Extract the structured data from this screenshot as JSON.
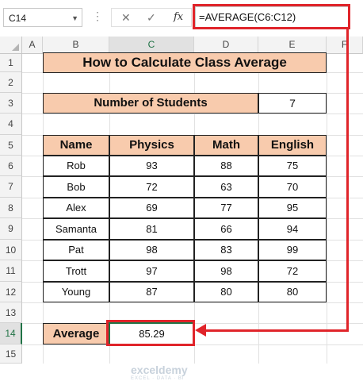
{
  "toolbar": {
    "name_box": "C14",
    "cancel_glyph": "✕",
    "enter_glyph": "✓",
    "fx_label": "fx",
    "formula": "=AVERAGE(C6:C12)"
  },
  "columns": [
    "A",
    "B",
    "C",
    "D",
    "E",
    "F"
  ],
  "rows": [
    "1",
    "2",
    "3",
    "4",
    "5",
    "6",
    "7",
    "8",
    "9",
    "10",
    "11",
    "12",
    "13",
    "14",
    "15"
  ],
  "sheet": {
    "title": "How to Calculate Class Average",
    "students_label": "Number of Students",
    "students_value": "7",
    "headers": [
      "Name",
      "Physics",
      "Math",
      "English"
    ],
    "data": [
      [
        "Rob",
        "93",
        "88",
        "75"
      ],
      [
        "Bob",
        "72",
        "63",
        "70"
      ],
      [
        "Alex",
        "69",
        "77",
        "95"
      ],
      [
        "Samanta",
        "81",
        "66",
        "94"
      ],
      [
        "Pat",
        "98",
        "83",
        "99"
      ],
      [
        "Trott",
        "97",
        "98",
        "72"
      ],
      [
        "Young",
        "87",
        "80",
        "80"
      ]
    ],
    "average_label": "Average",
    "average_value": "85.29"
  },
  "watermark": {
    "brand": "exceldemy",
    "tagline": "EXCEL · DATA · BI"
  },
  "colors": {
    "header_fill": "#f8cbad",
    "highlight": "#e0242a",
    "selection": "#217346"
  }
}
